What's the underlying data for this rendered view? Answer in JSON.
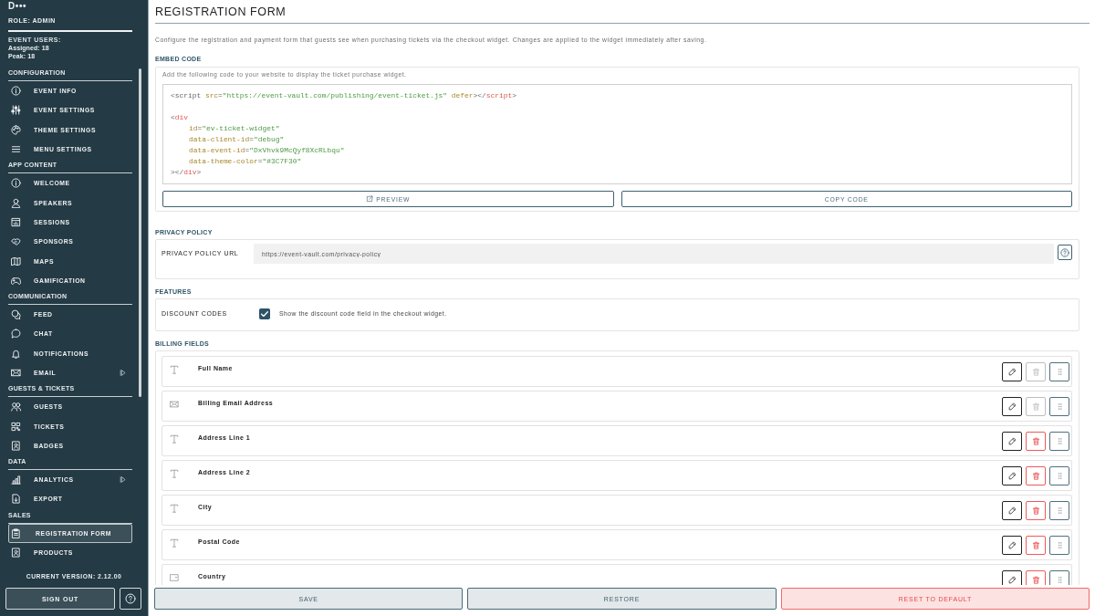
{
  "sidebar": {
    "account_name": "D•••",
    "role": "ROLE: ADMIN",
    "event_users": {
      "title": "EVENT USERS:",
      "assigned": "Assigned: 18",
      "peak": "Peak: 18"
    },
    "sections": [
      {
        "heading": "CONFIGURATION",
        "items": [
          {
            "label": "EVENT INFO",
            "selected": false
          },
          {
            "label": "EVENT SETTINGS",
            "selected": false
          },
          {
            "label": "THEME SETTINGS",
            "selected": false
          },
          {
            "label": "MENU SETTINGS",
            "selected": false
          }
        ]
      },
      {
        "heading": "APP CONTENT",
        "items": [
          {
            "label": "WELCOME",
            "selected": false
          },
          {
            "label": "SPEAKERS",
            "selected": false
          },
          {
            "label": "SESSIONS",
            "selected": false
          },
          {
            "label": "SPONSORS",
            "selected": false
          },
          {
            "label": "MAPS",
            "selected": false
          },
          {
            "label": "GAMIFICATION",
            "selected": false
          }
        ]
      },
      {
        "heading": "COMMUNICATION",
        "items": [
          {
            "label": "FEED",
            "selected": false
          },
          {
            "label": "CHAT",
            "selected": false
          },
          {
            "label": "NOTIFICATIONS",
            "selected": false
          },
          {
            "label": "EMAIL",
            "selected": false,
            "expanded": false
          }
        ]
      },
      {
        "heading": "GUESTS & TICKETS",
        "items": [
          {
            "label": "GUESTS",
            "selected": false
          },
          {
            "label": "TICKETS",
            "selected": false
          },
          {
            "label": "BADGES",
            "selected": false
          }
        ]
      },
      {
        "heading": "DATA",
        "items": [
          {
            "label": "ANALYTICS",
            "selected": false,
            "expanded": false
          },
          {
            "label": "EXPORT",
            "selected": false
          }
        ]
      },
      {
        "heading": "SALES",
        "items": [
          {
            "label": "REGISTRATION FORM",
            "selected": true
          },
          {
            "label": "PRODUCTS",
            "selected": false
          }
        ]
      }
    ],
    "version": "CURRENT VERSION: 2.12.00",
    "sign_out": "SIGN OUT"
  },
  "page": {
    "title": "REGISTRATION FORM",
    "description": "Configure the registration and payment form that guests see when purchasing tickets via the checkout widget. Changes are applied to the widget immediately after saving."
  },
  "embed_code": {
    "heading": "EMBED CODE",
    "hint": "Add the following code to your website to display the ticket purchase widget.",
    "blocks": [
      {
        "lines": [
          {
            "tokens": [
              {
                "kind": "punct",
                "text": "<script "
              },
              {
                "kind": "attr",
                "text": "src"
              },
              {
                "kind": "punct",
                "text": "="
              },
              {
                "kind": "string",
                "text": "\"https://event-vault.com/publishing/event-ticket.js\""
              },
              {
                "kind": "attr",
                "text": " defer"
              },
              {
                "kind": "punct",
                "text": "></"
              },
              {
                "kind": "tag",
                "text": "script"
              },
              {
                "kind": "punct",
                "text": ">"
              }
            ]
          }
        ]
      },
      {
        "lines": [
          {
            "tokens": [
              {
                "kind": "punct",
                "text": "<"
              },
              {
                "kind": "tag",
                "text": "div"
              }
            ],
            "children": [
              {
                "tokens": [
                  {
                    "kind": "attr",
                    "text": "id"
                  },
                  {
                    "kind": "punct",
                    "text": "="
                  },
                  {
                    "kind": "string",
                    "text": "\"ev-ticket-widget\""
                  }
                ]
              },
              {
                "tokens": [
                  {
                    "kind": "attr",
                    "text": "data-client-id"
                  },
                  {
                    "kind": "punct",
                    "text": "="
                  },
                  {
                    "kind": "string",
                    "text": "\"debug\""
                  }
                ]
              },
              {
                "tokens": [
                  {
                    "kind": "attr",
                    "text": "data-event-id"
                  },
                  {
                    "kind": "punct",
                    "text": "="
                  },
                  {
                    "kind": "string",
                    "text": "\"DxVhvk9McQyf8XcRLbqu\""
                  }
                ]
              },
              {
                "tokens": [
                  {
                    "kind": "attr",
                    "text": "data-theme-color"
                  },
                  {
                    "kind": "punct",
                    "text": "="
                  },
                  {
                    "kind": "string",
                    "text": "\"#3C7F30\""
                  }
                ]
              }
            ]
          },
          {
            "tokens": [
              {
                "kind": "punct",
                "text": "></"
              },
              {
                "kind": "tag",
                "text": "div"
              },
              {
                "kind": "punct",
                "text": ">"
              }
            ]
          }
        ]
      }
    ],
    "buttons": [
      {
        "label": "PREVIEW",
        "kind": "external"
      },
      {
        "label": "COPY CODE",
        "kind": "plain"
      }
    ]
  },
  "privacy_policy": {
    "heading": "PRIVACY POLICY",
    "label": "PRIVACY POLICY URL",
    "value": "https://event-vault.com/privacy-policy"
  },
  "features": {
    "heading": "FEATURES",
    "items": [
      {
        "label": "DISCOUNT CODES",
        "checked": true,
        "description": "Show the discount code field in the checkout widget."
      }
    ]
  },
  "billing_fields": {
    "heading": "BILLING FIELDS",
    "fields": [
      {
        "kind": "text",
        "label": "Full Name",
        "delete_disabled": true
      },
      {
        "kind": "email",
        "label": "Billing Email Address",
        "delete_disabled": true
      },
      {
        "kind": "text",
        "label": "Address Line 1",
        "delete_disabled": false
      },
      {
        "kind": "text",
        "label": "Address Line 2",
        "delete_disabled": false
      },
      {
        "kind": "text",
        "label": "City",
        "delete_disabled": false
      },
      {
        "kind": "text",
        "label": "Postal Code",
        "delete_disabled": false
      },
      {
        "kind": "select",
        "label": "Country",
        "delete_disabled": false
      }
    ]
  },
  "actions": [
    {
      "label": "SAVE",
      "kind": "neutral"
    },
    {
      "label": "RESTORE",
      "kind": "neutral"
    },
    {
      "label": "RESET TO DEFAULT",
      "kind": "danger"
    }
  ]
}
